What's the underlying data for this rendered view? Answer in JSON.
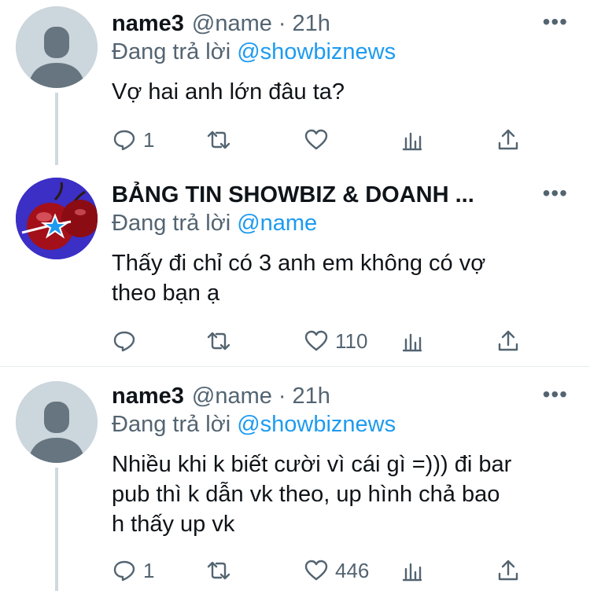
{
  "tweets": [
    {
      "name": "name3",
      "handle": "@name",
      "dot": "·",
      "time": "21h",
      "replying_label": "Đang trả lời",
      "replying_to": "@showbiznews",
      "text": "Vợ hai anh lớn đâu ta?",
      "reply_count": "1",
      "retweet_count": "",
      "like_count": "",
      "more": "•••",
      "avatar": "default-avatar"
    },
    {
      "name": "BẢNG TIN SHOWBIZ & DOANH ...",
      "replying_label": "Đang trả lời",
      "replying_to": "@name",
      "text_line1": "Thấy đi chỉ có 3 anh em không có vợ",
      "text_line2": "theo bạn ạ",
      "reply_count": "",
      "retweet_count": "",
      "like_count": "110",
      "more": "•••",
      "avatar": "cherry-star-logo"
    },
    {
      "name": "name3",
      "handle": "@name",
      "dot": "·",
      "time": "21h",
      "replying_label": "Đang trả lời",
      "replying_to": "@showbiznews",
      "text_line1": "Nhiều khi k biết cười vì cái gì =))) đi bar",
      "text_line2": "pub thì k dẫn vk theo, up hình chả bao",
      "text_line3": "h thấy up vk",
      "reply_count": "1",
      "retweet_count": "",
      "like_count": "446",
      "more": "•••",
      "avatar": "default-avatar"
    }
  ],
  "colors": {
    "link": "#1d9bf0",
    "secondary": "#536471",
    "thread_line": "#cfd9de"
  }
}
